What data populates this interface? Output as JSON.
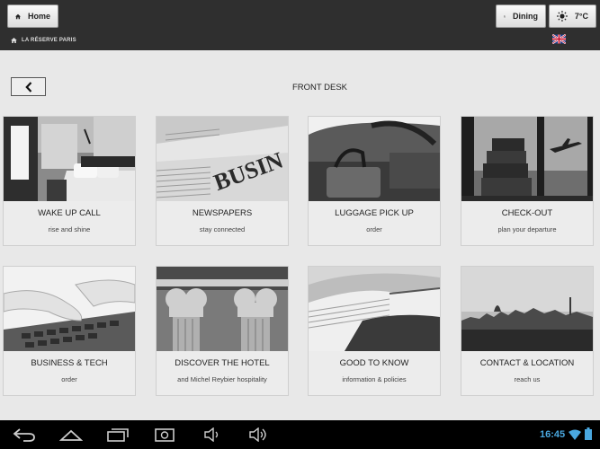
{
  "header": {
    "home_label": "Home",
    "dining_label": "Dining",
    "weather_label": "7°C",
    "breadcrumb": "LA RÉSERVE PARIS",
    "language_flag": "uk-flag-icon"
  },
  "page": {
    "title": "FRONT DESK"
  },
  "tiles": [
    {
      "title": "WAKE UP CALL",
      "subtitle": "rise and shine",
      "image": "hotel-bedroom"
    },
    {
      "title": "NEWSPAPERS",
      "subtitle": "stay connected",
      "image": "newspapers"
    },
    {
      "title": "LUGGAGE PICK UP",
      "subtitle": "order",
      "image": "luggage-bag"
    },
    {
      "title": "CHECK-OUT",
      "subtitle": "plan your departure",
      "image": "suitcases-airplane"
    },
    {
      "title": "BUSINESS & TECH",
      "subtitle": "order",
      "image": "hands-keyboard"
    },
    {
      "title": "DISCOVER THE HOTEL",
      "subtitle": "and Michel Reybier hospitality",
      "image": "corinthian-columns"
    },
    {
      "title": "GOOD TO KNOW",
      "subtitle": "information & policies",
      "image": "open-book"
    },
    {
      "title": "CONTACT & LOCATION",
      "subtitle": "reach us",
      "image": "paris-skyline"
    }
  ],
  "system_bar": {
    "time": "16:45"
  },
  "colors": {
    "topbar": "#2f2f2f",
    "background": "#e8e8e8",
    "clock": "#4aa8e0"
  }
}
